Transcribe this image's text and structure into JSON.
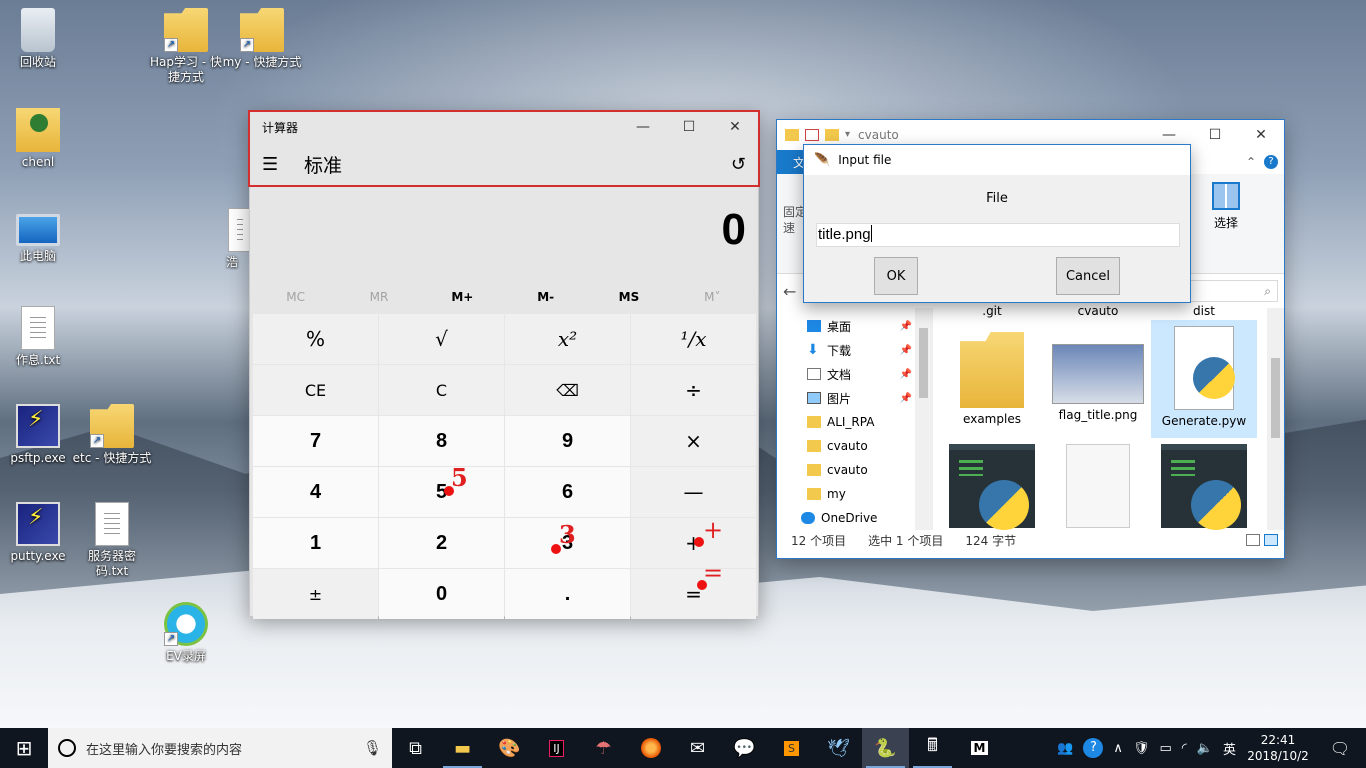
{
  "desktop": {
    "icons": [
      {
        "label": "回收站"
      },
      {
        "label": "chenl"
      },
      {
        "label": "此电脑"
      },
      {
        "label": "作息.txt"
      },
      {
        "label": "psftp.exe"
      },
      {
        "label": "putty.exe"
      },
      {
        "label": "Hap学习 - 快捷方式"
      },
      {
        "label": "my - 快捷方式"
      },
      {
        "label": "浩"
      },
      {
        "label": "etc - 快捷方式"
      },
      {
        "label": "服务器密码.txt"
      },
      {
        "label": "EV录屏"
      }
    ]
  },
  "calculator": {
    "title": "计算器",
    "mode": "标准",
    "display": "0",
    "memory": [
      "MC",
      "MR",
      "M+",
      "M-",
      "MS",
      "M˅"
    ],
    "keys": {
      "percent": "%",
      "sqrt": "√",
      "square": "x²",
      "reciprocal": "¹/x",
      "ce": "CE",
      "c": "C",
      "backspace": "⌫",
      "divide": "÷",
      "seven": "7",
      "eight": "8",
      "nine": "9",
      "multiply": "×",
      "four": "4",
      "five": "5",
      "six": "6",
      "minus": "—",
      "one": "1",
      "two": "2",
      "three": "3",
      "plus": "+",
      "negate": "±",
      "zero": "0",
      "decimal": ".",
      "equals": "="
    },
    "annotations": {
      "five": "5",
      "three": "3",
      "plus": "+",
      "equals": "="
    }
  },
  "explorer": {
    "title": "cvauto",
    "file_tab": "文",
    "ribbon": {
      "pin_label": "固定\n速",
      "select_label": "选择"
    },
    "search_placeholder": "o\"",
    "nav": [
      {
        "label": "桌面",
        "pinned": true
      },
      {
        "label": "下载",
        "pinned": true
      },
      {
        "label": "文档",
        "pinned": true
      },
      {
        "label": "图片",
        "pinned": true
      },
      {
        "label": "ALI_RPA",
        "pinned": false
      },
      {
        "label": "cvauto",
        "pinned": false
      },
      {
        "label": "cvauto",
        "pinned": false
      },
      {
        "label": "my",
        "pinned": false
      },
      {
        "label": "OneDrive",
        "pinned": false
      }
    ],
    "top_row_names": [
      ".git",
      "cvauto",
      "dist"
    ],
    "files": [
      {
        "name": "examples",
        "kind": "folder"
      },
      {
        "name": "flag_title.png",
        "kind": "image"
      },
      {
        "name": "Generate.pyw",
        "kind": "python",
        "selected": true
      },
      {
        "name": "",
        "kind": "python-window"
      },
      {
        "name": "",
        "kind": "blank"
      },
      {
        "name": "",
        "kind": "python-window"
      }
    ],
    "status": {
      "count": "12 个项目",
      "selected": "选中 1 个项目",
      "size": "124 字节"
    }
  },
  "dialog": {
    "title": "Input file",
    "label": "File",
    "value": "title.png",
    "ok": "OK",
    "cancel": "Cancel"
  },
  "taskbar": {
    "search_placeholder": "在这里输入你要搜索的内容",
    "apps": [
      "task-view",
      "file-explorer",
      "paint",
      "intellij",
      "maps",
      "firefox",
      "mail",
      "wechat",
      "sublime",
      "feather-app",
      "python",
      "calculator",
      "m-app"
    ],
    "tray": {
      "ime": "英",
      "time": "22:41",
      "date": "2018/10/2"
    }
  }
}
